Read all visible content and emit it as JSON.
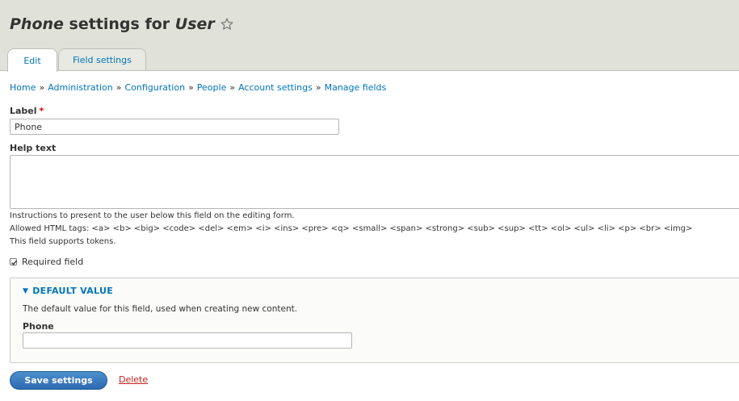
{
  "header": {
    "title_field": "Phone",
    "title_mid": " settings for ",
    "title_entity": "User",
    "tabs": [
      {
        "label": "Edit",
        "active": true
      },
      {
        "label": "Field settings",
        "active": false
      }
    ]
  },
  "breadcrumb": {
    "items": [
      "Home",
      "Administration",
      "Configuration",
      "People",
      "Account settings",
      "Manage fields"
    ],
    "separator": "»"
  },
  "form": {
    "label": {
      "title": "Label",
      "required_mark": "*",
      "value": "Phone"
    },
    "help_text": {
      "title": "Help text",
      "value": ""
    },
    "descriptions": [
      "Instructions to present to the user below this field on the editing form.",
      "Allowed HTML tags: <a> <b> <big> <code> <del> <em> <i> <ins> <pre> <q> <small> <span> <strong> <sub> <sup> <tt> <ol> <ul> <li> <p> <br> <img>",
      "This field supports tokens."
    ],
    "required": {
      "label": "Required field",
      "checked": true
    }
  },
  "default_value": {
    "legend": "DEFAULT VALUE",
    "description": "The default value for this field, used when creating new content.",
    "phone_label": "Phone",
    "phone_value": ""
  },
  "actions": {
    "save_label": "Save settings",
    "delete_label": "Delete"
  },
  "colors": {
    "header_bg": "#e0e2d9",
    "link": "#0074bd",
    "primary_button": "#2e69b3",
    "delete_link": "#c4211c",
    "required": "#e00000"
  },
  "icons": {
    "title_star": "star-outline-icon",
    "collapse": "triangle-down-icon",
    "checkbox": "checkmark-icon"
  }
}
